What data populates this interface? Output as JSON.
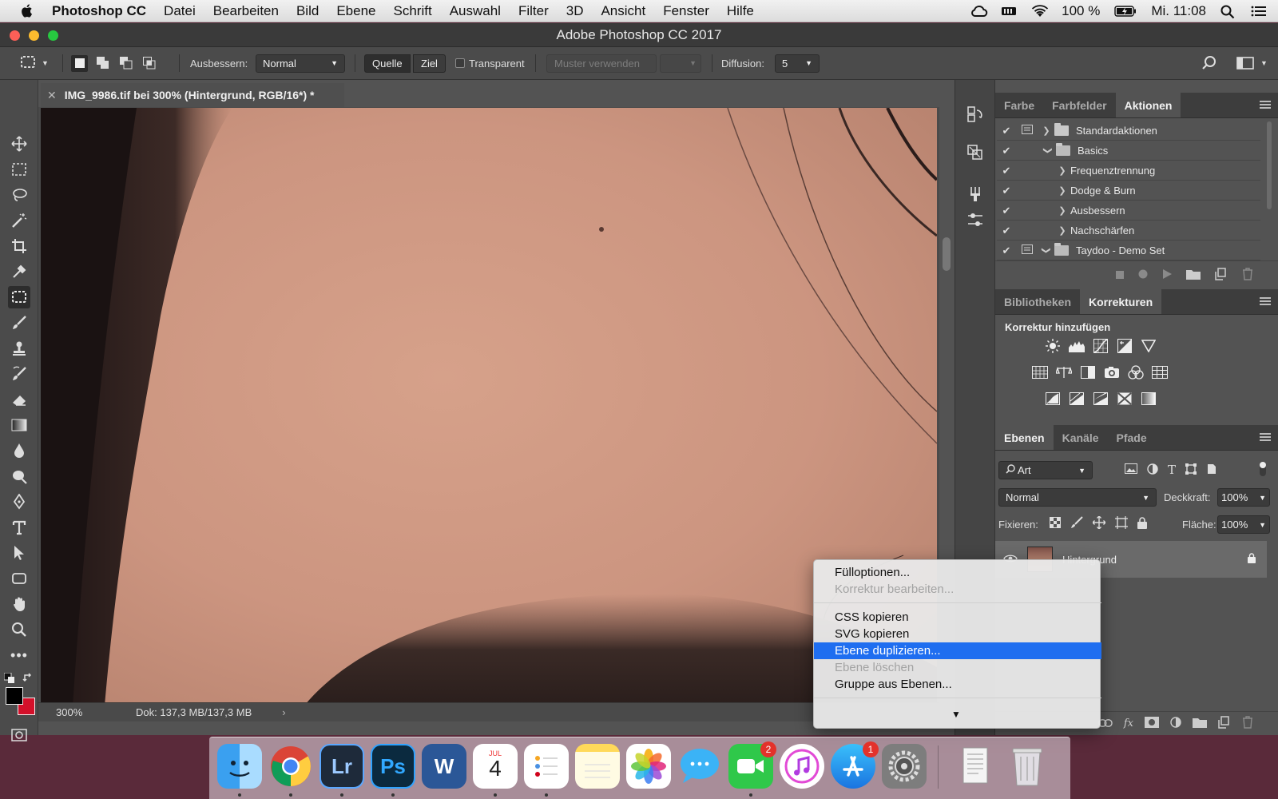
{
  "menubar": {
    "apple": "",
    "app": "Photoshop CC",
    "items": [
      "Datei",
      "Bearbeiten",
      "Bild",
      "Ebene",
      "Schrift",
      "Auswahl",
      "Filter",
      "3D",
      "Ansicht",
      "Fenster",
      "Hilfe"
    ],
    "battery": "100 %",
    "clock": "Mi. 11:08"
  },
  "window": {
    "title": "Adobe Photoshop CC 2017"
  },
  "options": {
    "ausbessern_label": "Ausbessern:",
    "ausbessern_value": "Normal",
    "quelle": "Quelle",
    "ziel": "Ziel",
    "transparent": "Transparent",
    "muster": "Muster verwenden",
    "diffusion_label": "Diffusion:",
    "diffusion_value": "5"
  },
  "document": {
    "tab_title": "IMG_9986.tif bei 300% (Hintergrund, RGB/16*) *",
    "zoom": "300%",
    "doc_info": "Dok: 137,3 MB/137,3 MB"
  },
  "actions_panel": {
    "tabs": [
      "Farbe",
      "Farbfelder",
      "Aktionen"
    ],
    "rows": [
      {
        "label": "Standardaktionen",
        "level": 0,
        "expanded": false,
        "folder": true
      },
      {
        "label": "Basics",
        "level": 0,
        "expanded": true,
        "folder": true
      },
      {
        "label": "Frequenztrennung",
        "level": 1,
        "expanded": false,
        "folder": false
      },
      {
        "label": "Dodge & Burn",
        "level": 1,
        "expanded": false,
        "folder": false
      },
      {
        "label": "Ausbessern",
        "level": 1,
        "expanded": false,
        "folder": false
      },
      {
        "label": "Nachschärfen",
        "level": 1,
        "expanded": false,
        "folder": false
      },
      {
        "label": "Taydoo - Demo Set",
        "level": 0,
        "expanded": true,
        "folder": true
      }
    ]
  },
  "adjustments_panel": {
    "tabs": [
      "Bibliotheken",
      "Korrekturen"
    ],
    "heading": "Korrektur hinzufügen"
  },
  "layers_panel": {
    "tabs": [
      "Ebenen",
      "Kanäle",
      "Pfade"
    ],
    "filter": "Art",
    "blend": "Normal",
    "opacity_label": "Deckkraft:",
    "opacity": "100%",
    "lock_label": "Fixieren:",
    "fill_label": "Fläche:",
    "fill": "100%",
    "layer_name": "Hintergrund"
  },
  "context_menu": {
    "items": [
      {
        "label": "Fülloptionen...",
        "disabled": false
      },
      {
        "label": "Korrektur bearbeiten...",
        "disabled": true
      },
      {
        "label": "CSS kopieren",
        "disabled": false
      },
      {
        "label": "SVG kopieren",
        "disabled": false
      },
      {
        "label": "Ebene duplizieren...",
        "disabled": false,
        "highlighted": true
      },
      {
        "label": "Ebene löschen",
        "disabled": true
      },
      {
        "label": "Gruppe aus Ebenen...",
        "disabled": false
      }
    ]
  },
  "dock": {
    "calendar_month": "JUL",
    "calendar_day": "4",
    "facetime_badge": "2",
    "appstore_badge": "1"
  },
  "colors": {
    "highlight": "#1f6ef0",
    "foreground": "#000000",
    "background": "#d3102a"
  }
}
